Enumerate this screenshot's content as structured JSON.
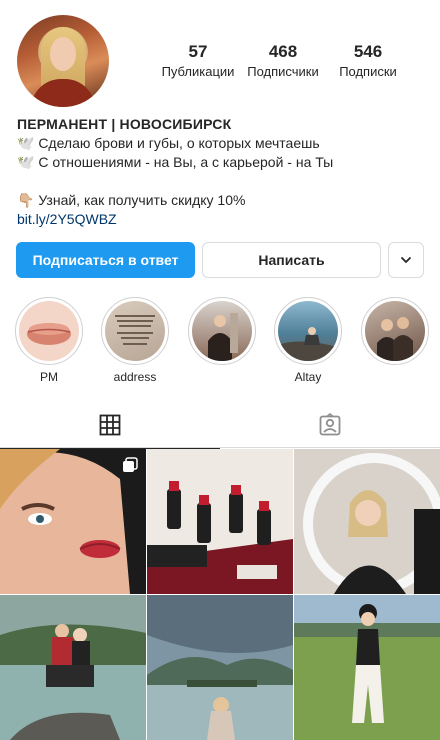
{
  "profile": {
    "stats": [
      {
        "value": "57",
        "label": "Публикации"
      },
      {
        "value": "468",
        "label": "Подписчики"
      },
      {
        "value": "546",
        "label": "Подписки"
      }
    ],
    "bio": {
      "name": "ПЕРМАНЕНТ | НОВОСИБИРСК",
      "line1": "🕊️ Сделаю брови и губы, о которых мечтаешь",
      "line2": "🕊️ С отношениями - на Вы, а с карьерой - на Ты",
      "line3": "👇🏼 Узнай, как получить скидку 10%",
      "link": "bit.ly/2Y5QWBZ"
    }
  },
  "actions": {
    "follow_back": "Подписаться в ответ",
    "message": "Написать"
  },
  "highlights": [
    {
      "label": "PM"
    },
    {
      "label": "address"
    },
    {
      "label": ""
    },
    {
      "label": "Altay"
    },
    {
      "label": ""
    }
  ],
  "tabs": [
    {
      "icon": "grid-icon",
      "active": true
    },
    {
      "icon": "tagged-person-icon",
      "active": false
    }
  ],
  "colors": {
    "primary_button": "#1e9af1",
    "link": "#00376b",
    "text": "#262626",
    "border": "#dbdbdb"
  }
}
